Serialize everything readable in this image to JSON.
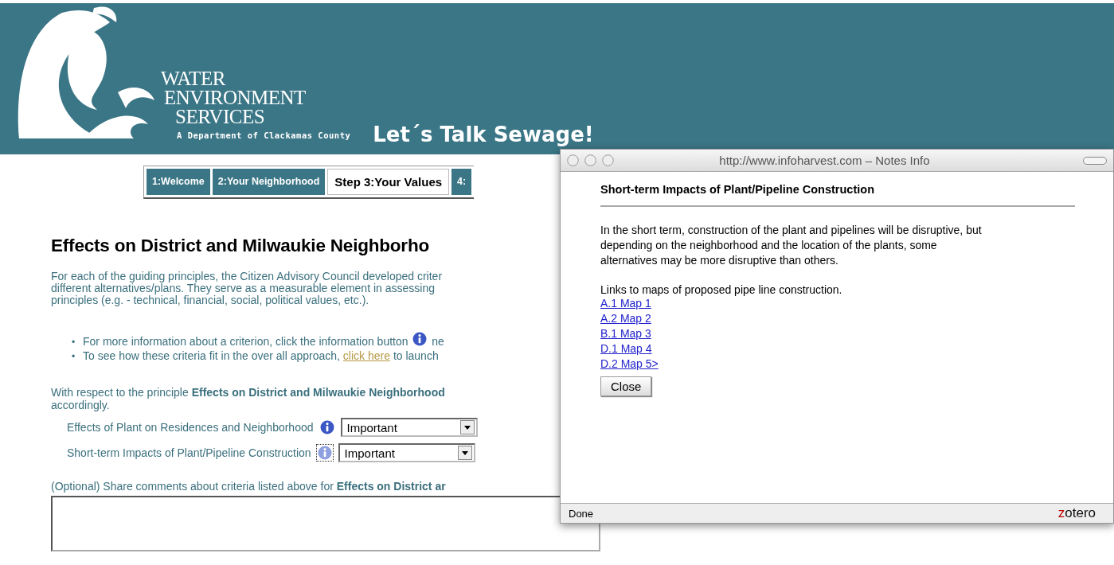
{
  "header": {
    "logo_lines": [
      "WATER",
      "ENVIRONMENT",
      "SERVICES"
    ],
    "subtitle": "A Department of Clackamas County",
    "slogan": "Let´s Talk Sewage!"
  },
  "tabs": [
    {
      "label": "1:Welcome",
      "selected": false
    },
    {
      "label": "2:Your Neighborhood",
      "selected": false
    },
    {
      "label": "Step 3:Your Values",
      "selected": true
    },
    {
      "label": "4:",
      "selected": false
    }
  ],
  "page": {
    "heading": "Effects on District and Milwaukie Neighborho",
    "intro_lines": [
      "For each of the guiding principles, the Citizen Advisory Council developed criter",
      "different alternatives/plans. They serve as a measurable element in assessing",
      "principles (e.g. - technical, financial, social, political values, etc.)."
    ],
    "bullets": [
      {
        "marker": "•",
        "kind": "info",
        "before": "For more information about a criterion, click the information button",
        "after": "ne"
      },
      {
        "marker": "•",
        "kind": "link",
        "before": "To see how these criteria fit in the over all approach,",
        "link": "click here",
        "after": "to launch"
      }
    ],
    "principle_lines": [
      "With respect to the principle **Effects on District and Milwaukie Neighborhood**",
      "accordingly."
    ],
    "criteria": [
      {
        "label": "Effects of Plant on Residences and Neighborhood",
        "focused": false,
        "value": "Important"
      },
      {
        "label": "Short-term Impacts of Plant/Pipeline Construction",
        "focused": true,
        "value": "Important"
      }
    ],
    "comment_label": "(Optional) Share comments about criteria listed above for **Effects on District ar**"
  },
  "popup": {
    "title": "http://www.infoharvest.com – Notes Info",
    "heading": "Short-term Impacts of Plant/Pipeline Construction",
    "body_lines": [
      "In the short term, construction of the plant and pipelines will be disruptive, but",
      "depending on the neighborhood and the location of the plants, some",
      "alternatives may be more disruptive than others."
    ],
    "links_intro": "Links to maps of proposed pipe line construction.",
    "links": [
      "A.1 Map 1",
      "A.2 Map 2",
      "B.1 Map 3",
      "D.1 Map 4",
      "D.2 Map 5>"
    ],
    "button": "Close",
    "status": "Done",
    "brand_first": "z",
    "brand_rest": "otero"
  }
}
